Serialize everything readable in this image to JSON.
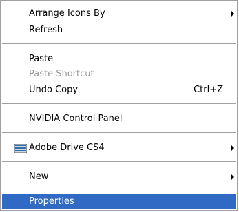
{
  "menu": {
    "items": [
      {
        "label": "Arrange Icons By"
      },
      {
        "label": "Refresh"
      },
      {
        "label": "Paste"
      },
      {
        "label": "Paste Shortcut"
      },
      {
        "label": "Undo Copy",
        "shortcut": "Ctrl+Z"
      },
      {
        "label": "NVIDIA Control Panel"
      },
      {
        "label": "Adobe Drive CS4",
        "icon": "adobe-drive-icon"
      },
      {
        "label": "New"
      },
      {
        "label": "Properties"
      }
    ]
  },
  "colors": {
    "highlight": "#316ac5",
    "disabled_text": "#9a9a9a",
    "separator": "#a0a0a0"
  }
}
